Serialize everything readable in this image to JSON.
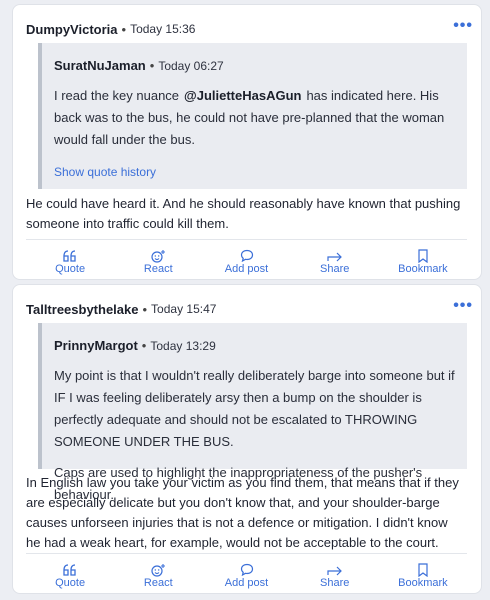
{
  "posts": [
    {
      "author": "DumpyVictoria",
      "separator": "•",
      "time": "Today 15:36",
      "more": "•••",
      "quote": {
        "author": "SuratNuJaman",
        "separator": "•",
        "time": "Today 06:27",
        "text_before": "I read the key nuance",
        "mention": "@JulietteHasAGun",
        "text_after": "has indicated here. His back was to the bus, he could not have pre-planned that the woman would fall under the bus.",
        "show_history": "Show quote history"
      },
      "body": "He could have heard it. And he should reasonably have known that pushing someone into traffic could kill them."
    },
    {
      "author": "Talltreesbythelake",
      "separator": "•",
      "time": "Today 15:47",
      "more": "•••",
      "quote": {
        "author": "PrinnyMargot",
        "separator": "•",
        "time": "Today 13:29",
        "paragraph1": "My point is that I wouldn't really deliberately barge into someone but if IF I was feeling deliberately arsy then a bump on the shoulder is perfectly adequate and should not be escalated to THROWING SOMEONE UNDER THE BUS.",
        "paragraph2": "Caps are used to highlight the inappropriateness of the pusher's behaviour."
      },
      "body": "In English law you take your victim as you find them, that means that if they are especially delicate but you don't know that, and your shoulder-barge causes unforseen injuries that is not a defence or mitigation. I didn't know he had a weak heart, for example, would not be acceptable to the court."
    }
  ],
  "actions": {
    "quote": "Quote",
    "react": "React",
    "add_post": "Add post",
    "share": "Share",
    "bookmark": "Bookmark"
  },
  "colors": {
    "accent": "#3b6fd8",
    "quote_bg": "#eaecf1",
    "page_bg": "#eceef3"
  }
}
